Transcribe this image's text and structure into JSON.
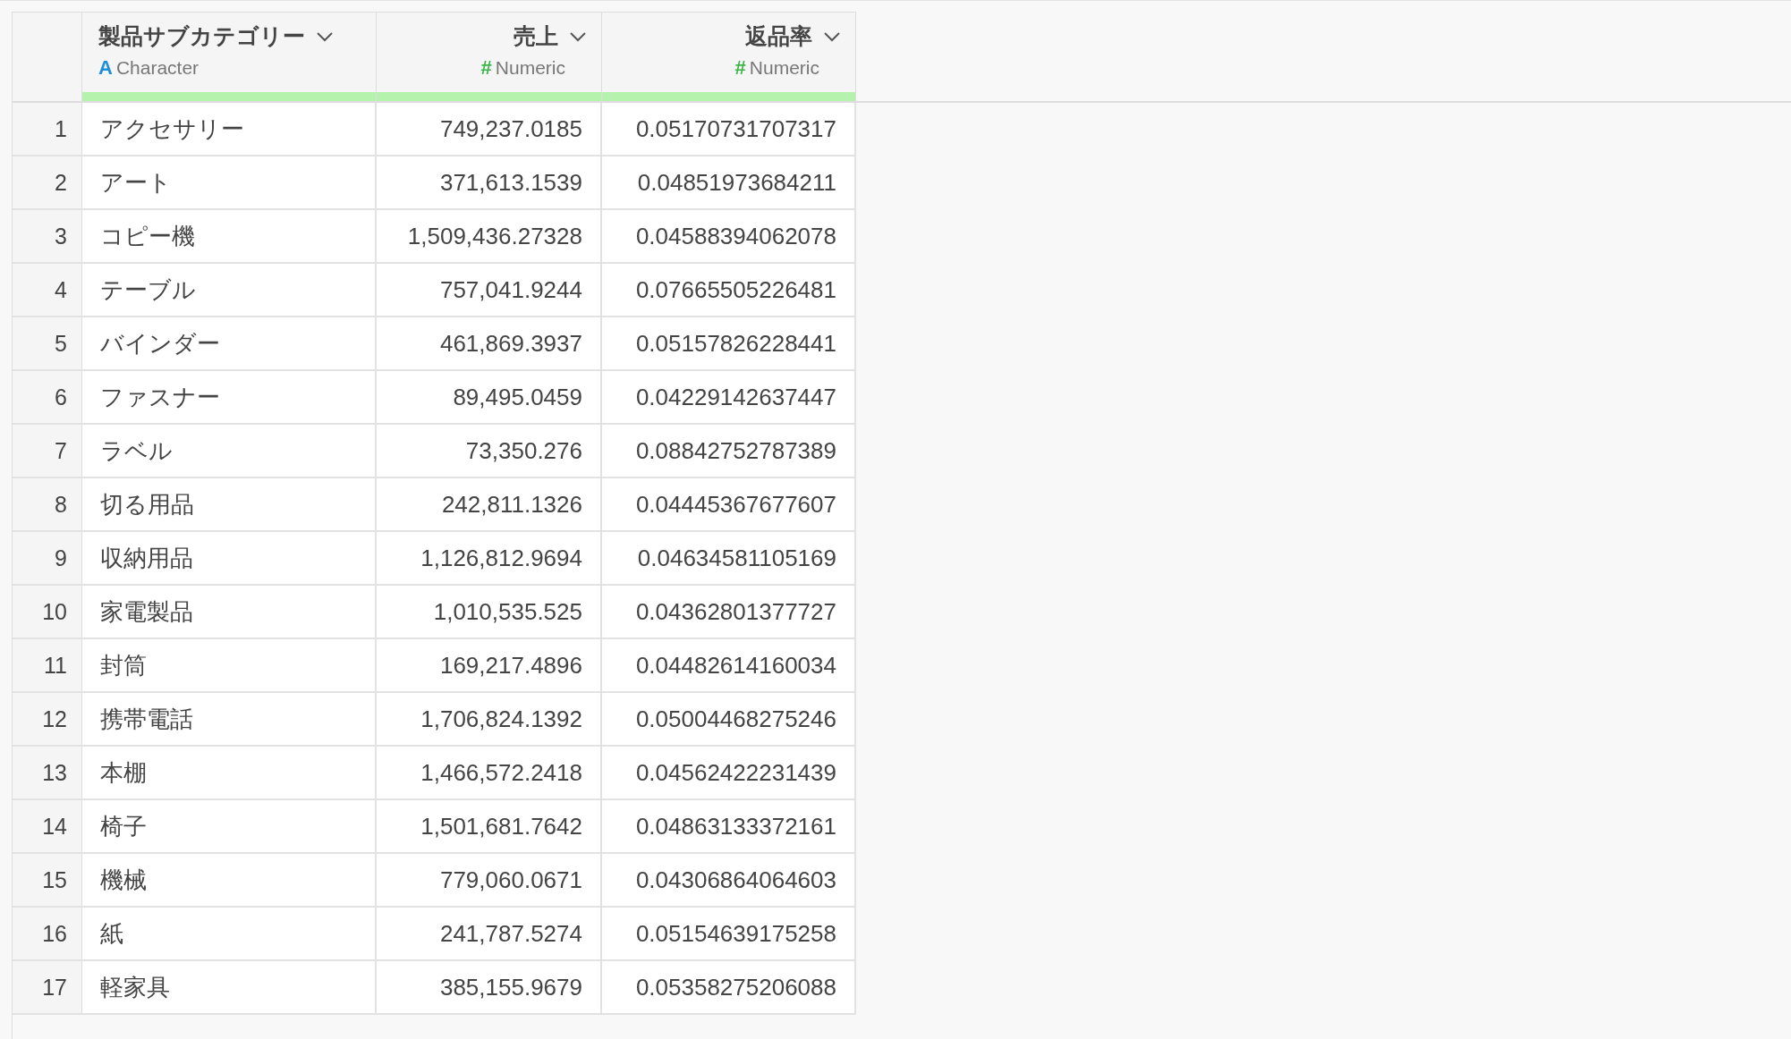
{
  "table": {
    "columns": [
      {
        "name": "製品サブカテゴリー",
        "kind": "character",
        "type_icon": "A",
        "type_label": "Character",
        "level": 1
      },
      {
        "name": "売上",
        "kind": "numeric",
        "type_icon": "#",
        "type_label": "Numeric",
        "level": 1
      },
      {
        "name": "返品率",
        "kind": "numeric",
        "type_icon": "#",
        "type_label": "Numeric",
        "level": 1
      }
    ],
    "rows": [
      {
        "index": "1",
        "cells": [
          "アクセサリー",
          "749,237.0185",
          "0.05170731707317"
        ]
      },
      {
        "index": "2",
        "cells": [
          "アート",
          "371,613.1539",
          "0.04851973684211"
        ]
      },
      {
        "index": "3",
        "cells": [
          "コピー機",
          "1,509,436.27328",
          "0.04588394062078"
        ]
      },
      {
        "index": "4",
        "cells": [
          "テーブル",
          "757,041.9244",
          "0.07665505226481"
        ]
      },
      {
        "index": "5",
        "cells": [
          "バインダー",
          "461,869.3937",
          "0.05157826228441"
        ]
      },
      {
        "index": "6",
        "cells": [
          "ファスナー",
          "89,495.0459",
          "0.04229142637447"
        ]
      },
      {
        "index": "7",
        "cells": [
          "ラベル",
          "73,350.276",
          "0.08842752787389"
        ]
      },
      {
        "index": "8",
        "cells": [
          "切る用品",
          "242,811.1326",
          "0.04445367677607"
        ]
      },
      {
        "index": "9",
        "cells": [
          "収納用品",
          "1,126,812.9694",
          "0.04634581105169"
        ]
      },
      {
        "index": "10",
        "cells": [
          "家電製品",
          "1,010,535.525",
          "0.04362801377727"
        ]
      },
      {
        "index": "11",
        "cells": [
          "封筒",
          "169,217.4896",
          "0.04482614160034"
        ]
      },
      {
        "index": "12",
        "cells": [
          "携帯電話",
          "1,706,824.1392",
          "0.05004468275246"
        ]
      },
      {
        "index": "13",
        "cells": [
          "本棚",
          "1,466,572.2418",
          "0.04562422231439"
        ]
      },
      {
        "index": "14",
        "cells": [
          "椅子",
          "1,501,681.7642",
          "0.04863133372161"
        ]
      },
      {
        "index": "15",
        "cells": [
          "機械",
          "779,060.0671",
          "0.04306864064603"
        ]
      },
      {
        "index": "16",
        "cells": [
          "紙",
          "241,787.5274",
          "0.05154639175258"
        ]
      },
      {
        "index": "17",
        "cells": [
          "軽家具",
          "385,155.9679",
          "0.05358275206088"
        ]
      }
    ]
  }
}
